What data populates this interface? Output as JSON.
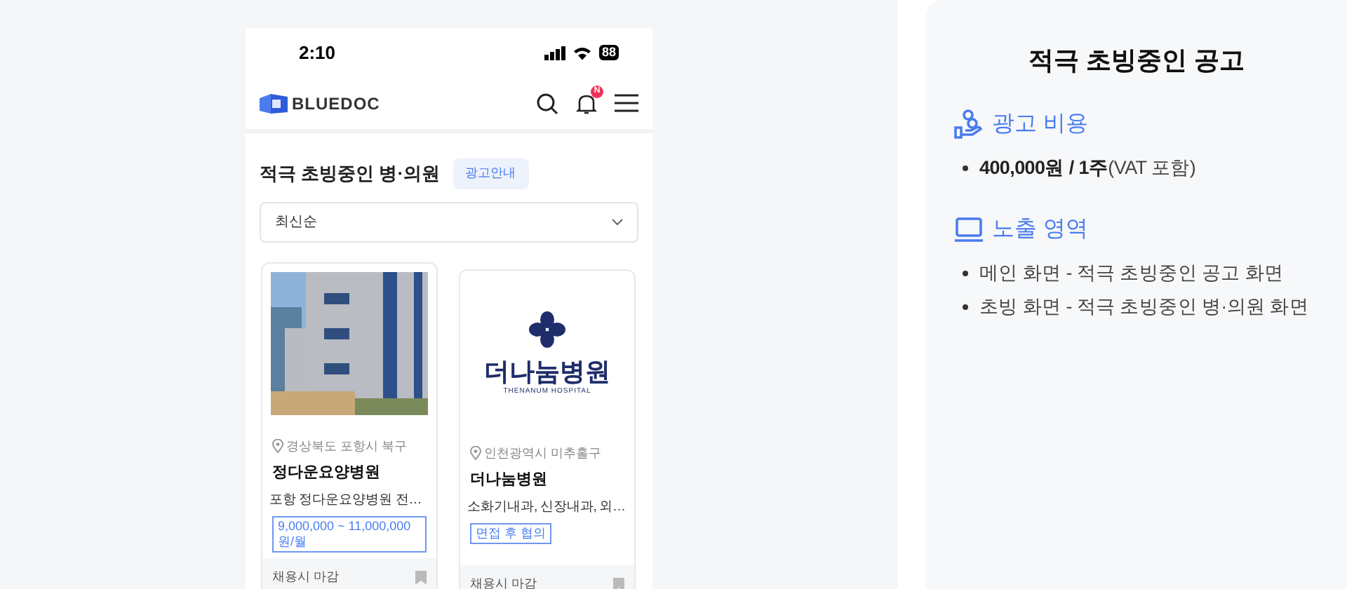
{
  "phone": {
    "status_bar": {
      "time": "2:10",
      "battery": "88"
    },
    "header": {
      "logo": "BLUEDOC",
      "notification_badge": "N"
    },
    "section_title": "적극 초빙중인 병·의원",
    "ad_info_button": "광고안내",
    "sort_dropdown": {
      "value": "최신순"
    },
    "cards": [
      {
        "location": "경상북도 포항시 북구",
        "name": "정다운요양병원",
        "description": "포항 정다운요양병원 전…",
        "pay": "9,000,000 ~ 11,000,000 원/월",
        "deadline": "채용시 마감"
      },
      {
        "kind": "logo",
        "logo_name": "더나눔병원",
        "logo_subtitle": "THENANUM HOSPITAL",
        "location": "인천광역시 미추홀구",
        "name": "더나눔병원",
        "description": "소화기내과, 신장내과, 외…",
        "pay": "면접 후 협의",
        "deadline": "채용시 마감"
      }
    ]
  },
  "info_panel": {
    "title": "적극 초빙중인 공고",
    "sections": [
      {
        "kind": "cost",
        "heading": "광고 비용",
        "items": [
          "**400,000원 / 1주**(VAT 포함)"
        ]
      },
      {
        "kind": "exposure",
        "heading": "노출 영역",
        "items": [
          "메인 화면 - 적극 초빙중인 공고 화면",
          "초빙 화면 - 적극 초빙중인 병·의원 화면"
        ]
      }
    ]
  }
}
